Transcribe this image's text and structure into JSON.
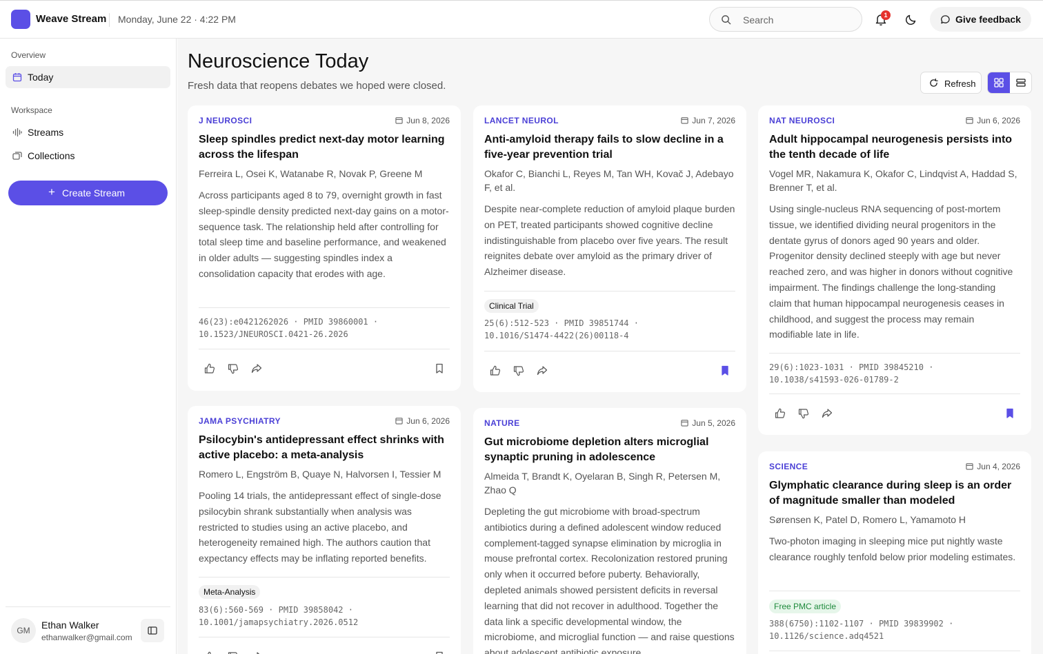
{
  "header": {
    "app_name": "Weave Stream",
    "datetime": "Monday, June 22 · 4:22 PM",
    "search_placeholder": "Search",
    "notification_count": "1",
    "feedback_label": "Give feedback"
  },
  "sidebar": {
    "overview_label": "Overview",
    "today_label": "Today",
    "workspace_label": "Workspace",
    "streams_label": "Streams",
    "collections_label": "Collections",
    "create_label": "Create Stream",
    "user": {
      "initials": "GM",
      "name": "Ethan Walker",
      "email": "ethanwalker@gmail.com"
    }
  },
  "main": {
    "title": "Neuroscience Today",
    "subtitle": "Fresh data that reopens debates we hoped were closed.",
    "refresh_label": "Refresh"
  },
  "cards": [
    {
      "journal": "J NEUROSCI",
      "date": "Jun 8, 2026",
      "title": "Sleep spindles predict next-day motor learning across the lifespan",
      "authors": "Ferreira L, Osei K, Watanabe R, Novak P, Greene M",
      "abstract": "Across participants aged 8 to 79, overnight growth in fast sleep-spindle density predicted next-day gains on a motor-sequence task. The relationship held after controlling for total sleep time and baseline performance, and weakened in older adults — suggesting spindles index a consolidation capacity that erodes with age.",
      "tag": "",
      "cite_line1": "46(23):e0421262026 · PMID 39860001 ·",
      "cite_line2": "10.1523/JNEUROSCI.0421-26.2026",
      "bookmarked": false
    },
    {
      "journal": "LANCET NEUROL",
      "date": "Jun 7, 2026",
      "title": "Anti-amyloid therapy fails to slow decline in a five-year prevention trial",
      "authors": "Okafor C, Bianchi L, Reyes M, Tan WH, Kovač J, Adebayo F, et al.",
      "abstract": "Despite near-complete reduction of amyloid plaque burden on PET, treated participants showed cognitive decline indistinguishable from placebo over five years. The result reignites debate over amyloid as the primary driver of Alzheimer disease.",
      "tag": "Clinical Trial",
      "cite_line1": "25(6):512-523 · PMID 39851744 ·",
      "cite_line2": "10.1016/S1474-4422(26)00118-4",
      "bookmarked": true
    },
    {
      "journal": "NAT NEUROSCI",
      "date": "Jun 6, 2026",
      "title": "Adult hippocampal neurogenesis persists into the tenth decade of life",
      "authors": "Vogel MR, Nakamura K, Okafor C, Lindqvist A, Haddad S, Brenner T, et al.",
      "abstract": "Using single-nucleus RNA sequencing of post-mortem tissue, we identified dividing neural progenitors in the dentate gyrus of donors aged 90 years and older. Progenitor density declined steeply with age but never reached zero, and was higher in donors without cognitive impairment. The findings challenge the long-standing claim that human hippocampal neurogenesis ceases in childhood, and suggest the process may remain modifiable late in life.",
      "tag": "",
      "cite_line1": "29(6):1023-1031 · PMID 39845210 ·",
      "cite_line2": "10.1038/s41593-026-01789-2",
      "bookmarked": true
    },
    {
      "journal": "JAMA PSYCHIATRY",
      "date": "Jun 6, 2026",
      "title": "Psilocybin's antidepressant effect shrinks with active placebo: a meta-analysis",
      "authors": "Romero L, Engström B, Quaye N, Halvorsen I, Tessier M",
      "abstract": "Pooling 14 trials, the antidepressant effect of single-dose psilocybin shrank substantially when analysis was restricted to studies using an active placebo, and heterogeneity remained high. The authors caution that expectancy effects may be inflating reported benefits.",
      "tag": "Meta-Analysis",
      "cite_line1": "83(6):560-569 · PMID 39858042 ·",
      "cite_line2": "10.1001/jamapsychiatry.2026.0512",
      "bookmarked": false
    },
    {
      "journal": "NATURE",
      "date": "Jun 5, 2026",
      "title": "Gut microbiome depletion alters microglial synaptic pruning in adolescence",
      "authors": "Almeida T, Brandt K, Oyelaran B, Singh R, Petersen M, Zhao Q",
      "abstract": "Depleting the gut microbiome with broad-spectrum antibiotics during a defined adolescent window reduced complement-tagged synapse elimination by microglia in mouse prefrontal cortex. Recolonization restored pruning only when it occurred before puberty. Behaviorally, depleted animals showed persistent deficits in reversal learning that did not recover in adulthood. Together the data link a specific developmental window, the microbiome, and microglial function — and raise questions about adolescent antibiotic exposure.",
      "tag": "",
      "cite_line1": "",
      "cite_line2": "",
      "bookmarked": false
    },
    {
      "journal": "SCIENCE",
      "date": "Jun 4, 2026",
      "title": "Glymphatic clearance during sleep is an order of magnitude smaller than modeled",
      "authors": "Sørensen K, Patel D, Romero L, Yamamoto H",
      "abstract": "Two-photon imaging in sleeping mice put nightly waste clearance roughly tenfold below prior modeling estimates.",
      "tag": "Free PMC article",
      "cite_line1": "388(6750):1102-1107 · PMID 39839902 ·",
      "cite_line2": "10.1126/science.adq4521",
      "bookmarked": false
    }
  ],
  "colors": {
    "accent": "#5b4fe6",
    "journal": "#4a3fd6",
    "badge": "#e5322d",
    "free_tag": "#1e8a3c"
  }
}
